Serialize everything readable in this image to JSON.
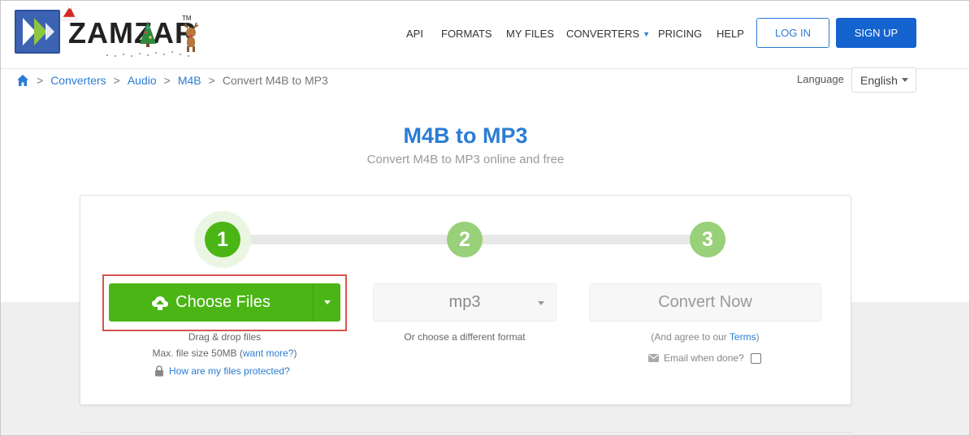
{
  "header": {
    "logo_text": "ZAMZAR",
    "logo_tm": "TM",
    "nav": [
      {
        "label": "API"
      },
      {
        "label": "FORMATS"
      },
      {
        "label": "MY FILES"
      },
      {
        "label": "CONVERTERS"
      },
      {
        "label": "PRICING"
      },
      {
        "label": "HELP"
      }
    ],
    "login_label": "LOG IN",
    "signup_label": "SIGN UP"
  },
  "breadcrumb": {
    "items": [
      "Converters",
      "Audio",
      "M4B"
    ],
    "current": "Convert M4B to MP3",
    "separator": ">"
  },
  "language": {
    "label": "Language",
    "selected": "English"
  },
  "title": "M4B to MP3",
  "subtitle": "Convert M4B to MP3 online and free",
  "steps": [
    "1",
    "2",
    "3"
  ],
  "step1": {
    "button_label": "Choose Files",
    "drag_hint": "Drag & drop files",
    "max_size_prefix": "Max. file size 50MB (",
    "want_more": "want more?",
    "max_size_suffix": ")",
    "protected_link": "How are my files protected?"
  },
  "step2": {
    "format": "mp3",
    "hint": "Or choose a different format"
  },
  "step3": {
    "button_label": "Convert Now",
    "terms_prefix": "(And agree to our ",
    "terms_link": "Terms",
    "terms_suffix": ")",
    "email_label": "Email when done?"
  },
  "colors": {
    "brand_blue": "#2b7cd3",
    "signup_blue": "#1463cf",
    "green": "#4bb515",
    "green_light": "#99d07a",
    "highlight_red": "#d9534f"
  }
}
